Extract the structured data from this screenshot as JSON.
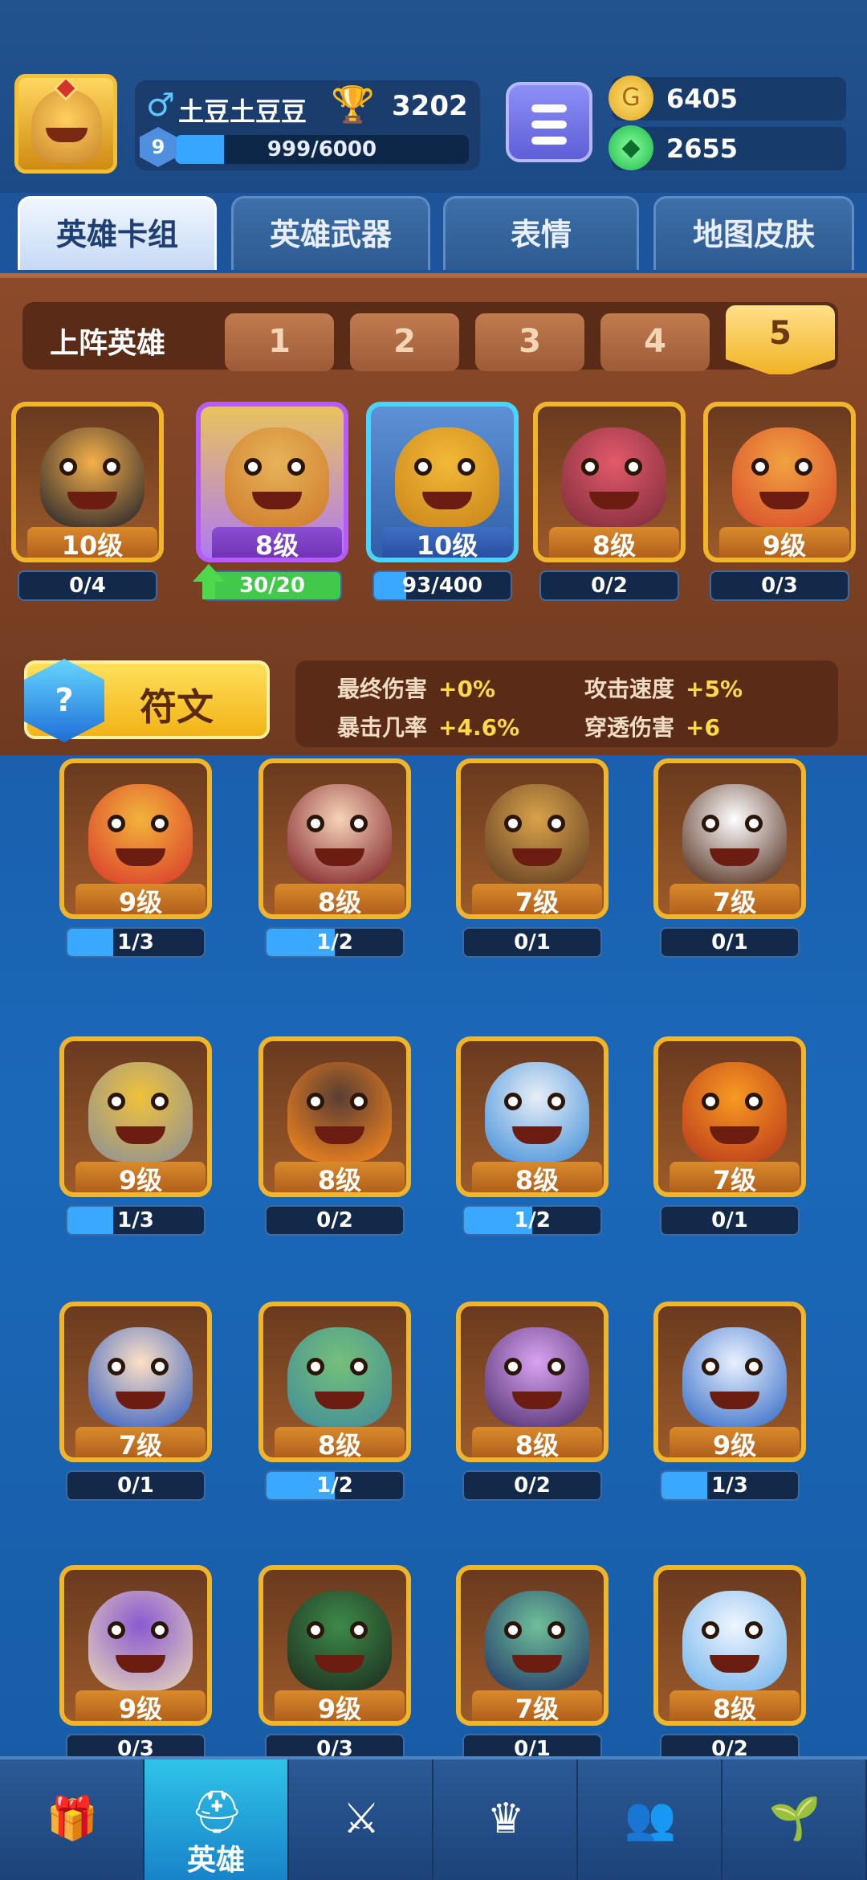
{
  "player": {
    "name": "土豆土豆豆",
    "gender_symbol": "♂",
    "trophies": "3202",
    "level": "9",
    "xp_text": "999/6000",
    "xp_fraction": 0.1665
  },
  "currency": {
    "gold": "6405",
    "gems": "2655"
  },
  "tabs": [
    "英雄卡组",
    "英雄武器",
    "表情",
    "地图皮肤"
  ],
  "deck": {
    "label": "上阵英雄",
    "slots": [
      "1",
      "2",
      "3",
      "4",
      "5"
    ],
    "active_slot": 5
  },
  "lineup": [
    {
      "level": "10级",
      "progress": "0/4",
      "fraction": 0,
      "frame": "gold",
      "colors": [
        "#f4b04a",
        "#1d1d2a"
      ]
    },
    {
      "level": "8级",
      "progress": "30/20",
      "fraction": 1,
      "frame": "purple",
      "upgrade": true,
      "colors": [
        "#e7b35a",
        "#cf7a2a"
      ]
    },
    {
      "level": "10级",
      "progress": "93/400",
      "fraction": 0.2325,
      "frame": "blue",
      "colors": [
        "#f2b938",
        "#c98419"
      ]
    },
    {
      "level": "8级",
      "progress": "0/2",
      "fraction": 0,
      "frame": "gold",
      "colors": [
        "#e25a6a",
        "#7b2b3a"
      ]
    },
    {
      "level": "9级",
      "progress": "0/3",
      "fraction": 0,
      "frame": "gold",
      "colors": [
        "#f1a241",
        "#d84a2a"
      ]
    }
  ],
  "rune": {
    "label": "符文"
  },
  "stats": [
    {
      "label": "最终伤害",
      "value": "+0%"
    },
    {
      "label": "攻击速度",
      "value": "+5%"
    },
    {
      "label": "暴击几率",
      "value": "+4.6%"
    },
    {
      "label": "穿透伤害",
      "value": "+6"
    }
  ],
  "collection": [
    {
      "level": "9级",
      "progress": "1/3",
      "fraction": 0.3333,
      "colors": [
        "#f2b43c",
        "#d9372a"
      ]
    },
    {
      "level": "8级",
      "progress": "1/2",
      "fraction": 0.5,
      "colors": [
        "#f6d3b8",
        "#7a1a22"
      ]
    },
    {
      "level": "7级",
      "progress": "0/1",
      "fraction": 0,
      "colors": [
        "#d9a24a",
        "#5b3a22"
      ]
    },
    {
      "level": "7级",
      "progress": "0/1",
      "fraction": 0,
      "colors": [
        "#ffffff",
        "#4a2312"
      ]
    },
    {
      "level": "9级",
      "progress": "1/3",
      "fraction": 0.3333,
      "colors": [
        "#f0c23a",
        "#8a8f9a"
      ]
    },
    {
      "level": "8级",
      "progress": "0/2",
      "fraction": 0,
      "colors": [
        "#5a3d33",
        "#ff8a1d"
      ]
    },
    {
      "level": "8级",
      "progress": "1/2",
      "fraction": 0.5,
      "colors": [
        "#e8eef7",
        "#3f8ed8"
      ]
    },
    {
      "level": "7级",
      "progress": "0/1",
      "fraction": 0,
      "colors": [
        "#f79a22",
        "#b8361b"
      ]
    },
    {
      "level": "7级",
      "progress": "0/1",
      "fraction": 0,
      "colors": [
        "#fde0c4",
        "#2e5bc2"
      ]
    },
    {
      "level": "8级",
      "progress": "1/2",
      "fraction": 0.5,
      "colors": [
        "#76c07a",
        "#3f8a9a"
      ]
    },
    {
      "level": "8级",
      "progress": "0/2",
      "fraction": 0,
      "colors": [
        "#d9a3f2",
        "#4a2c6a"
      ]
    },
    {
      "level": "9级",
      "progress": "1/3",
      "fraction": 0.3333,
      "colors": [
        "#e9f1ff",
        "#3068c4"
      ]
    },
    {
      "level": "9级",
      "progress": "0/3",
      "fraction": 0,
      "colors": [
        "#8a5ad1",
        "#e8d7b9"
      ]
    },
    {
      "level": "9级",
      "progress": "0/3",
      "fraction": 0,
      "colors": [
        "#3d8a4a",
        "#1d2a1d"
      ]
    },
    {
      "level": "7级",
      "progress": "0/1",
      "fraction": 0,
      "colors": [
        "#6fbf9a",
        "#1f3366"
      ]
    },
    {
      "level": "8级",
      "progress": "0/2",
      "fraction": 0,
      "colors": [
        "#eef5ff",
        "#6fb2ea"
      ]
    }
  ],
  "bottom_nav": [
    {
      "icon": "treasure-chest-icon",
      "glyph": "🎁",
      "label": ""
    },
    {
      "icon": "knight-helmet-icon",
      "glyph": "⛑",
      "label": "英雄",
      "active": true
    },
    {
      "icon": "crossed-swords-icon",
      "glyph": "⚔",
      "label": ""
    },
    {
      "icon": "crown-shield-icon",
      "glyph": "♛",
      "label": ""
    },
    {
      "icon": "team-banner-icon",
      "glyph": "👥",
      "label": ""
    },
    {
      "icon": "sprout-island-icon",
      "glyph": "🌱",
      "label": ""
    }
  ]
}
